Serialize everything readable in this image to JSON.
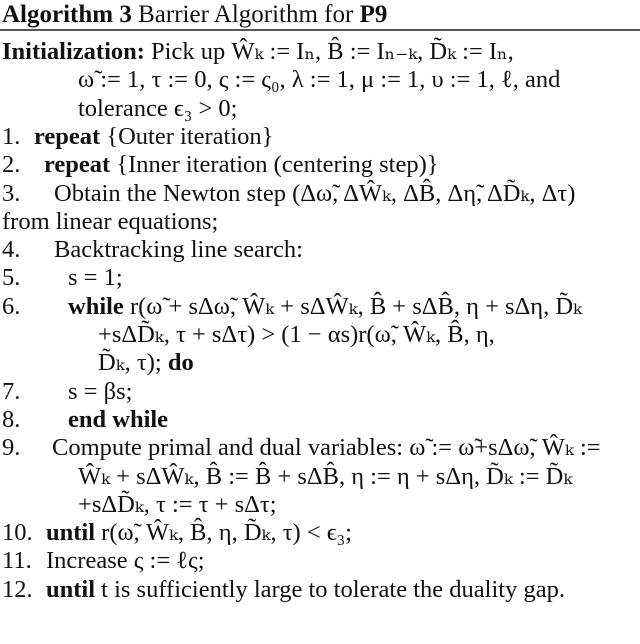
{
  "algorithm": {
    "title_label": "Algorithm 3",
    "title_text": "Barrier Algorithm for",
    "title_problem": "P9"
  },
  "lines": [
    {
      "id": "init-1",
      "num": "",
      "keyword": "Initialization:",
      "text": "Pick up Ŵₖ := Iₙ, B̂ := Iₙ₋ₖ, D̃ₖ := Iₙ,"
    },
    {
      "id": "init-2",
      "num": "",
      "keyword": "",
      "text": "ω̃ := 1, τ := 0, ς := ς₀, λ := 1, μ := 1, υ := 1, ℓ, and"
    },
    {
      "id": "init-3",
      "num": "",
      "keyword": "",
      "text": "tolerance ϵ₃ > 0;"
    },
    {
      "id": "l1",
      "num": "1.",
      "keyword": "repeat",
      "text": "{Outer iteration}"
    },
    {
      "id": "l2",
      "num": "2.",
      "keyword": "repeat",
      "text": "{Inner iteration (centering step)}"
    },
    {
      "id": "l3",
      "num": "3.",
      "keyword": "",
      "text": "Obtain the Newton step (Δω̃, ΔŴₖ, ΔB̂, Δη̃, ΔD̃ₖ, Δτ)"
    },
    {
      "id": "l3b",
      "num": "",
      "keyword": "",
      "text": "from linear equations;"
    },
    {
      "id": "l4",
      "num": "4.",
      "keyword": "",
      "text": "Backtracking line search:"
    },
    {
      "id": "l5",
      "num": "5.",
      "keyword": "",
      "text": "s = 1;"
    },
    {
      "id": "l6",
      "num": "6.",
      "keyword": "while",
      "text": "r(ω̃ + sΔω̃, Ŵₖ + sΔŴₖ, B̂ + sΔB̂, η + sΔη, D̃ₖ"
    },
    {
      "id": "l6b",
      "num": "",
      "keyword": "",
      "text": "+sΔD̃ₖ,  τ + sΔτ)  >  (1 − αs)r(ω̃,  Ŵₖ,  B̂,  η,"
    },
    {
      "id": "l6c",
      "num": "",
      "keyword": "",
      "text": "D̃ₖ,  τ);",
      "keyword_after": "do"
    },
    {
      "id": "l7",
      "num": "7.",
      "keyword": "",
      "text": "s = βs;"
    },
    {
      "id": "l8",
      "num": "8.",
      "keyword": "end while",
      "text": ""
    },
    {
      "id": "l9",
      "num": "9.",
      "keyword": "",
      "text": "Compute primal and dual variables: ω̃ := ω̃+sΔω̃, Ŵₖ :="
    },
    {
      "id": "l9b",
      "num": "",
      "keyword": "",
      "text": "Ŵₖ + sΔŴₖ, B̂ := B̂ + sΔB̂, η := η + sΔη, D̃ₖ := D̃ₖ"
    },
    {
      "id": "l9c",
      "num": "",
      "keyword": "",
      "text": "+sΔD̃ₖ, τ := τ + sΔτ;"
    },
    {
      "id": "l10",
      "num": "10.",
      "keyword": "until",
      "text": "r(ω̃, Ŵₖ, B̂, η, D̃ₖ, τ) < ϵ₃;"
    },
    {
      "id": "l11",
      "num": "11.",
      "keyword": "",
      "text": "Increase ς := ℓς;"
    },
    {
      "id": "l12",
      "num": "12.",
      "keyword": "until",
      "text": "t is sufficiently large to tolerate the duality gap."
    }
  ]
}
